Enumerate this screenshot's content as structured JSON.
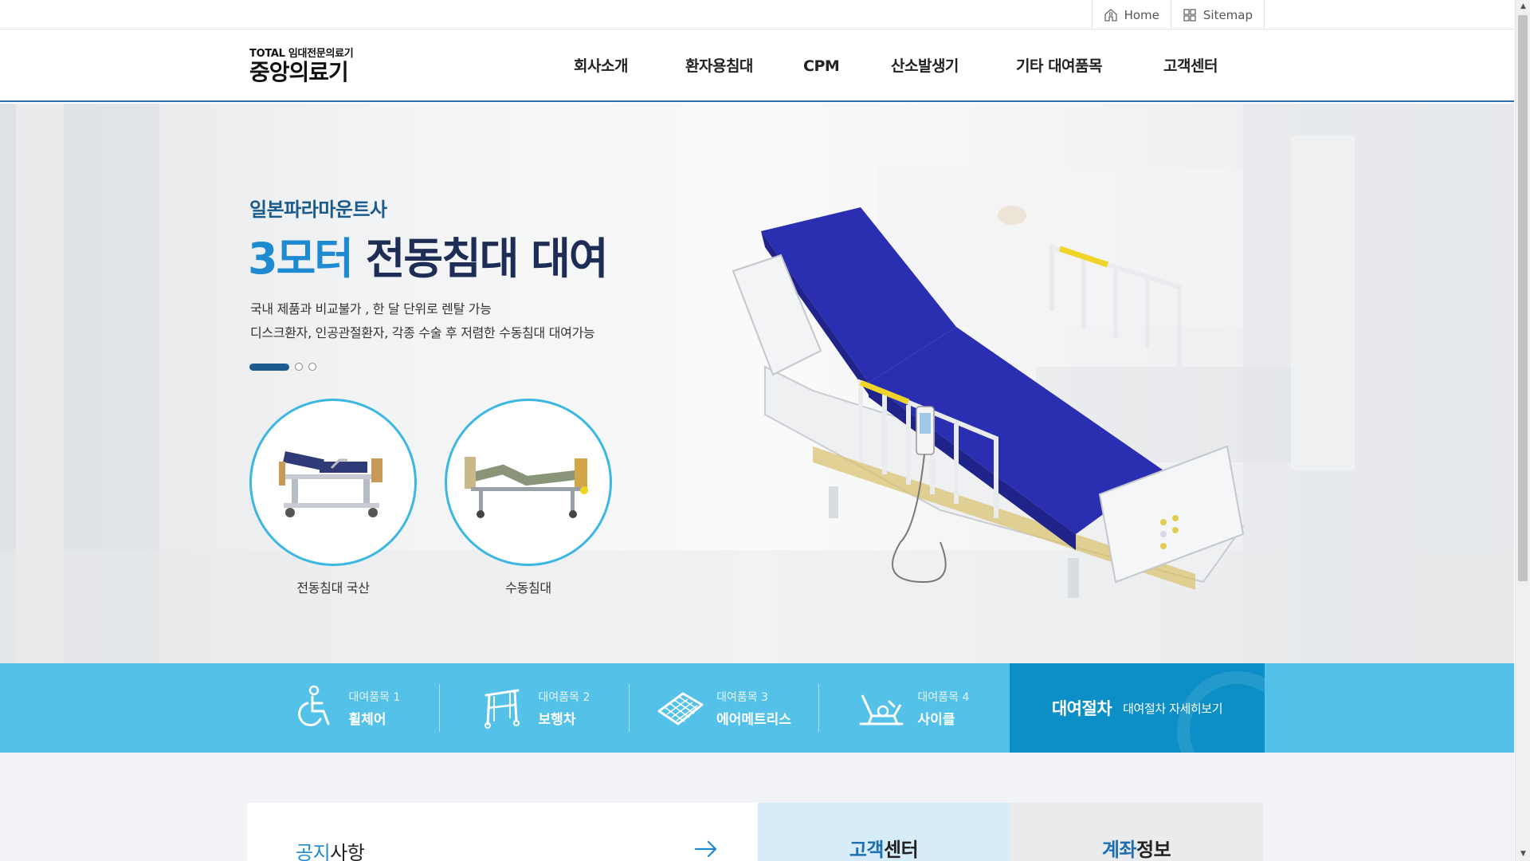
{
  "util": {
    "home_label": "Home",
    "sitemap_label": "Sitemap"
  },
  "logo": {
    "small": "TOTAL 임대전문의료기",
    "main": "중앙의료기"
  },
  "nav": {
    "items": [
      "회사소개",
      "환자용침대",
      "CPM",
      "산소발생기",
      "기타 대여품목",
      "고객센터"
    ]
  },
  "hero": {
    "subtitle": "일본파라마운트사",
    "title_accent": "3모터",
    "title_rest": " 전동침대 대여",
    "desc_line1": "국내 제품과 비교불가 , 한 달 단위로 렌탈 가능",
    "desc_line2": "디스크환자, 인공관절환자, 각종 수술 후 저렴한 수동침대 대여가능",
    "slide_current": 1,
    "slide_total": 3,
    "thumbs": [
      {
        "label": "전동침대 국산"
      },
      {
        "label": "수동침대"
      }
    ]
  },
  "rental": {
    "items": [
      {
        "small": "대여품목 1",
        "name": "휠체어",
        "icon": "wheelchair-icon"
      },
      {
        "small": "대여품목 2",
        "name": "보행차",
        "icon": "walker-icon"
      },
      {
        "small": "대여품목 3",
        "name": "에어메트리스",
        "icon": "air-mattress-icon"
      },
      {
        "small": "대여품목 4",
        "name": "사이클",
        "icon": "cycle-icon"
      }
    ],
    "procedure_title": "대여절차",
    "procedure_link": "대여절차 자세히보기"
  },
  "bottom": {
    "notice_accent": "공지",
    "notice_rest": "사항",
    "cs_accent": "고객",
    "cs_rest": "센터",
    "bank_accent": "계좌",
    "bank_rest": "정보"
  },
  "colors": {
    "accent_blue": "#1e8ad2",
    "band_blue": "#54c1e8",
    "procedure_blue": "#0b8fc6",
    "nav_border": "#2a6fb0",
    "mattress_blue": "#2a2fb2"
  }
}
